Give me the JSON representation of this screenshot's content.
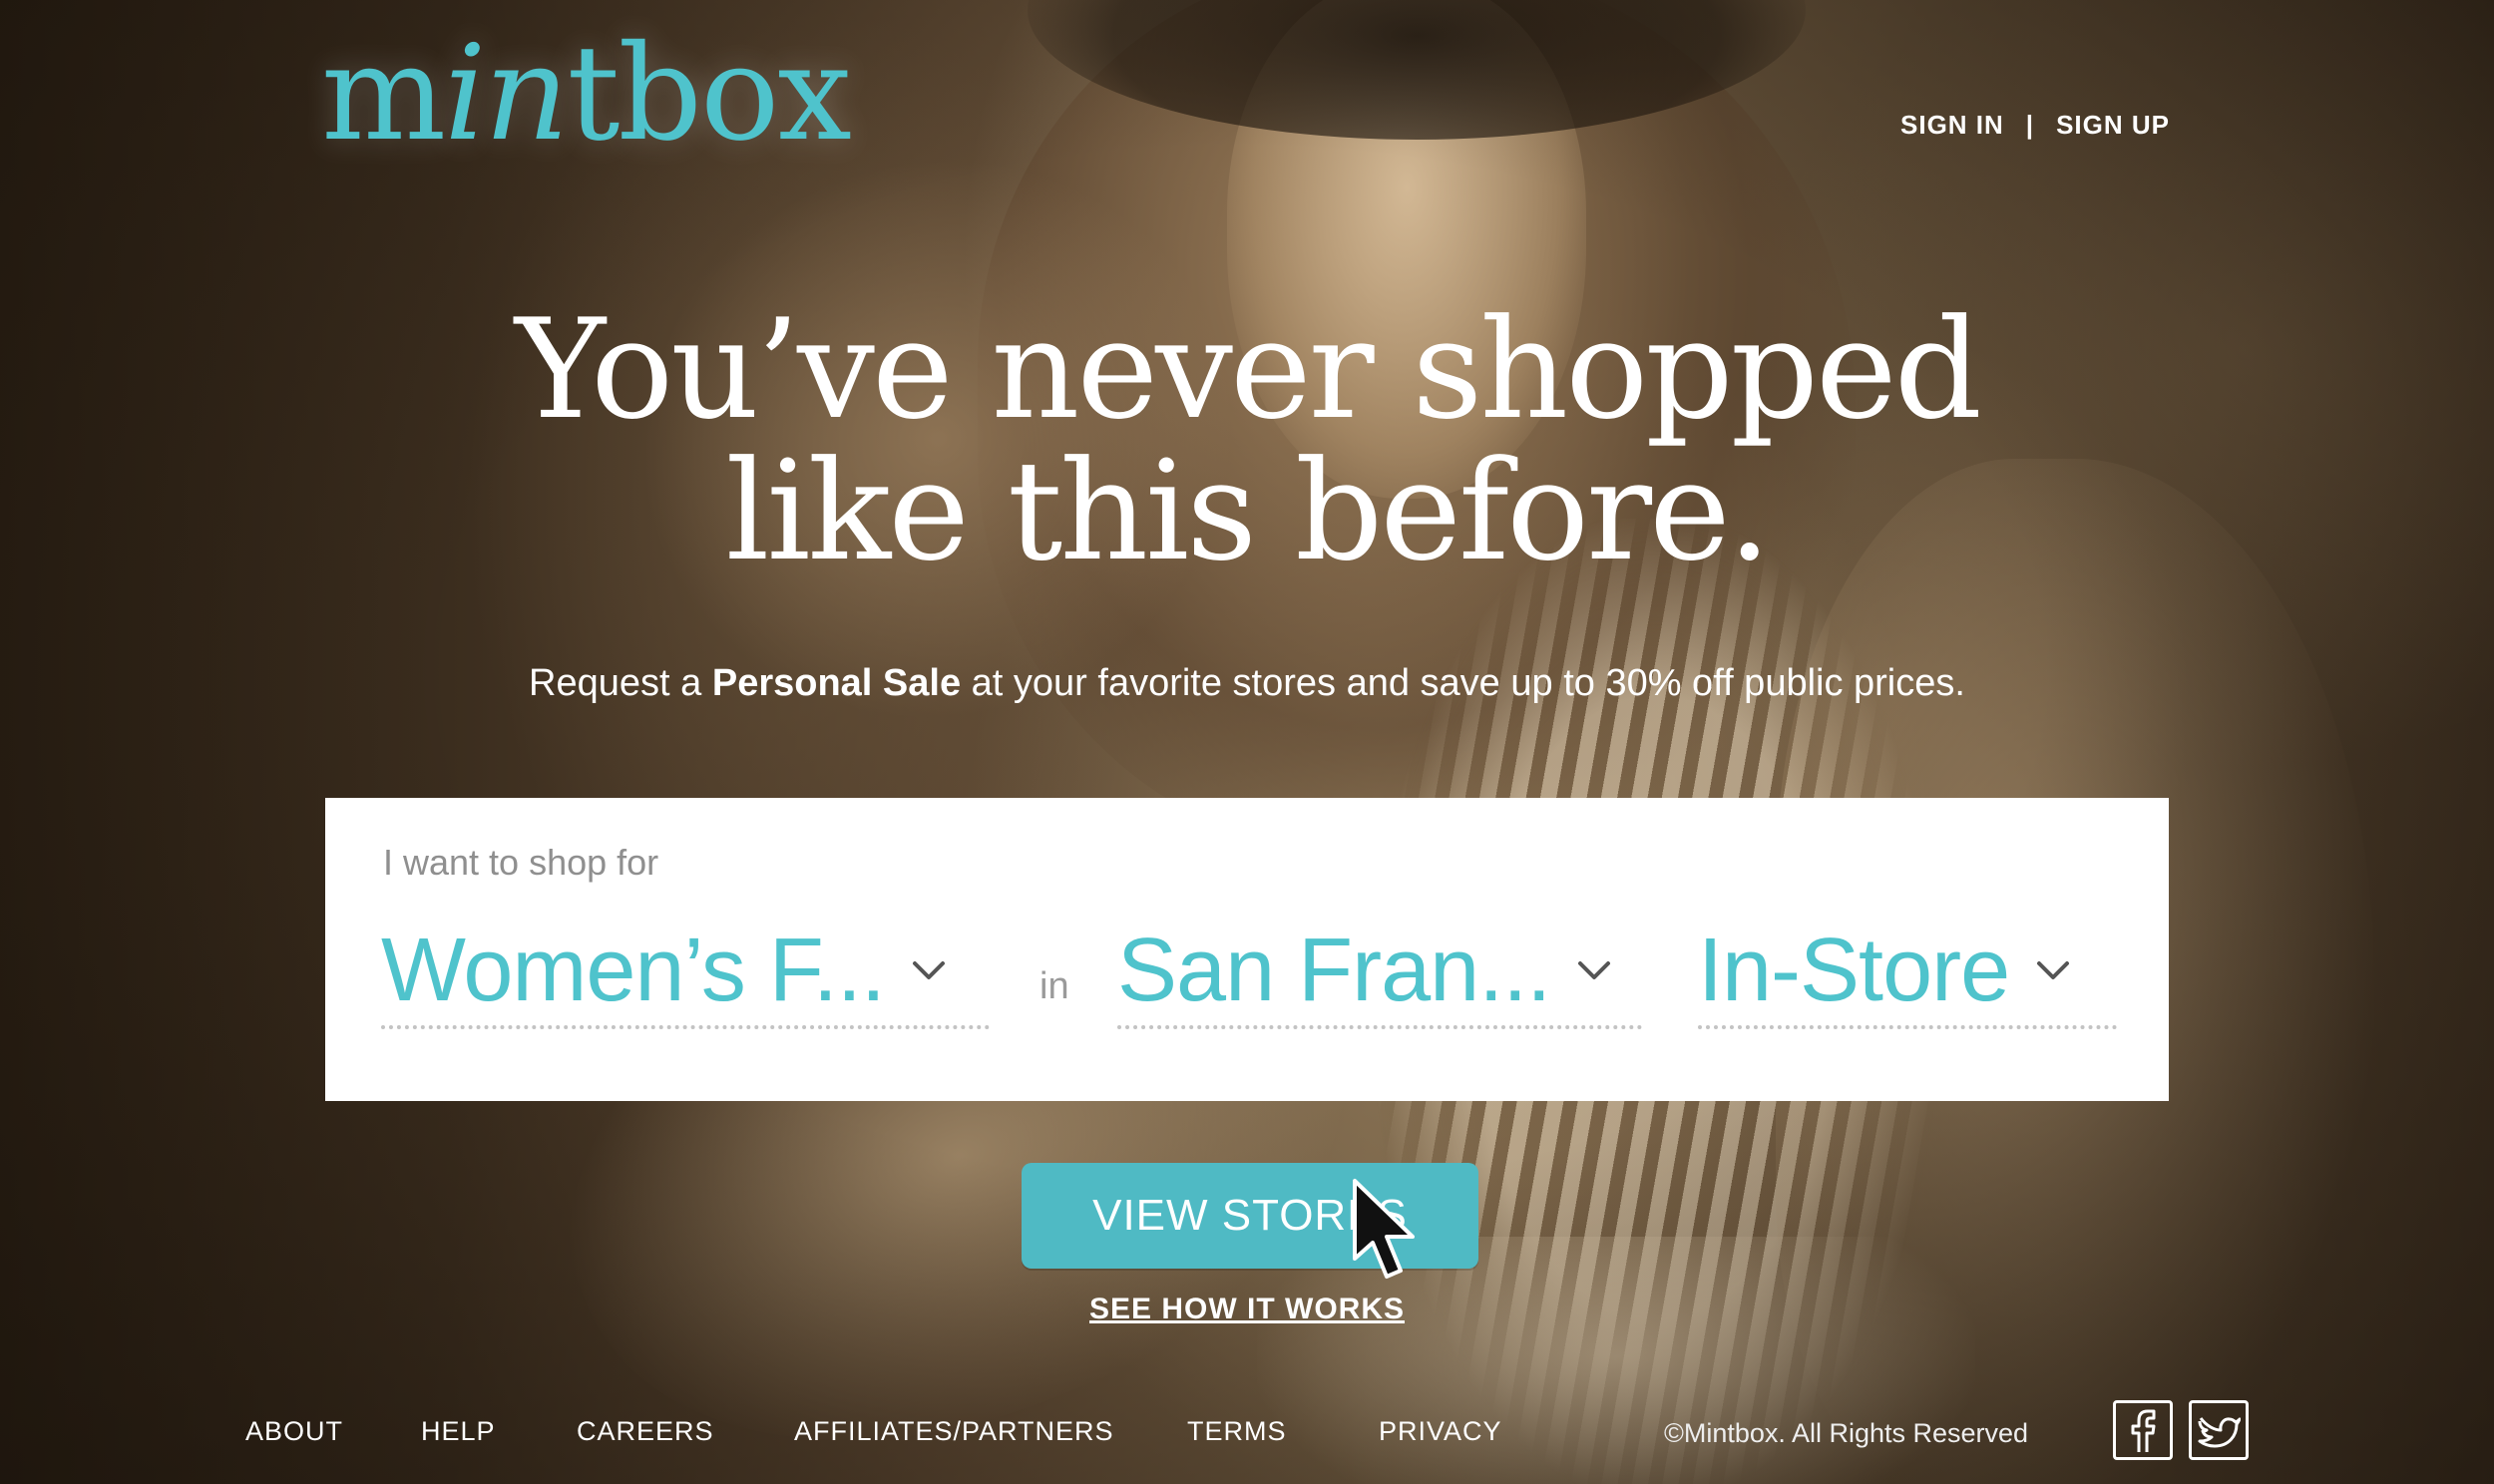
{
  "brand": {
    "logo_part1": "m",
    "logo_part2": "in",
    "logo_part3": "tbox",
    "accent_color": "#4fc3cc"
  },
  "header": {
    "sign_in": "SIGN IN",
    "separator": "|",
    "sign_up": "SIGN UP"
  },
  "hero": {
    "headline_line1": "You’ve never shopped",
    "headline_line2": "like this before.",
    "sub_prefix": "Request a ",
    "sub_bold": "Personal Sale",
    "sub_suffix": " at your favorite stores and save up to 30% off public prices."
  },
  "search": {
    "label": "I want to shop for",
    "category_value": "Women’s F...",
    "in_word": "in",
    "location_value": "San Fran...",
    "mode_value": "In-Store"
  },
  "cta": {
    "view_stores": "VIEW STORES",
    "see_how": "SEE HOW IT WORKS"
  },
  "footer": {
    "links": [
      "ABOUT",
      "HELP",
      "CAREERS",
      "AFFILIATES/PARTNERS",
      "TERMS",
      "PRIVACY"
    ],
    "copyright": "©Mintbox. All Rights Reserved",
    "icons": [
      "facebook-icon",
      "twitter-icon"
    ]
  }
}
